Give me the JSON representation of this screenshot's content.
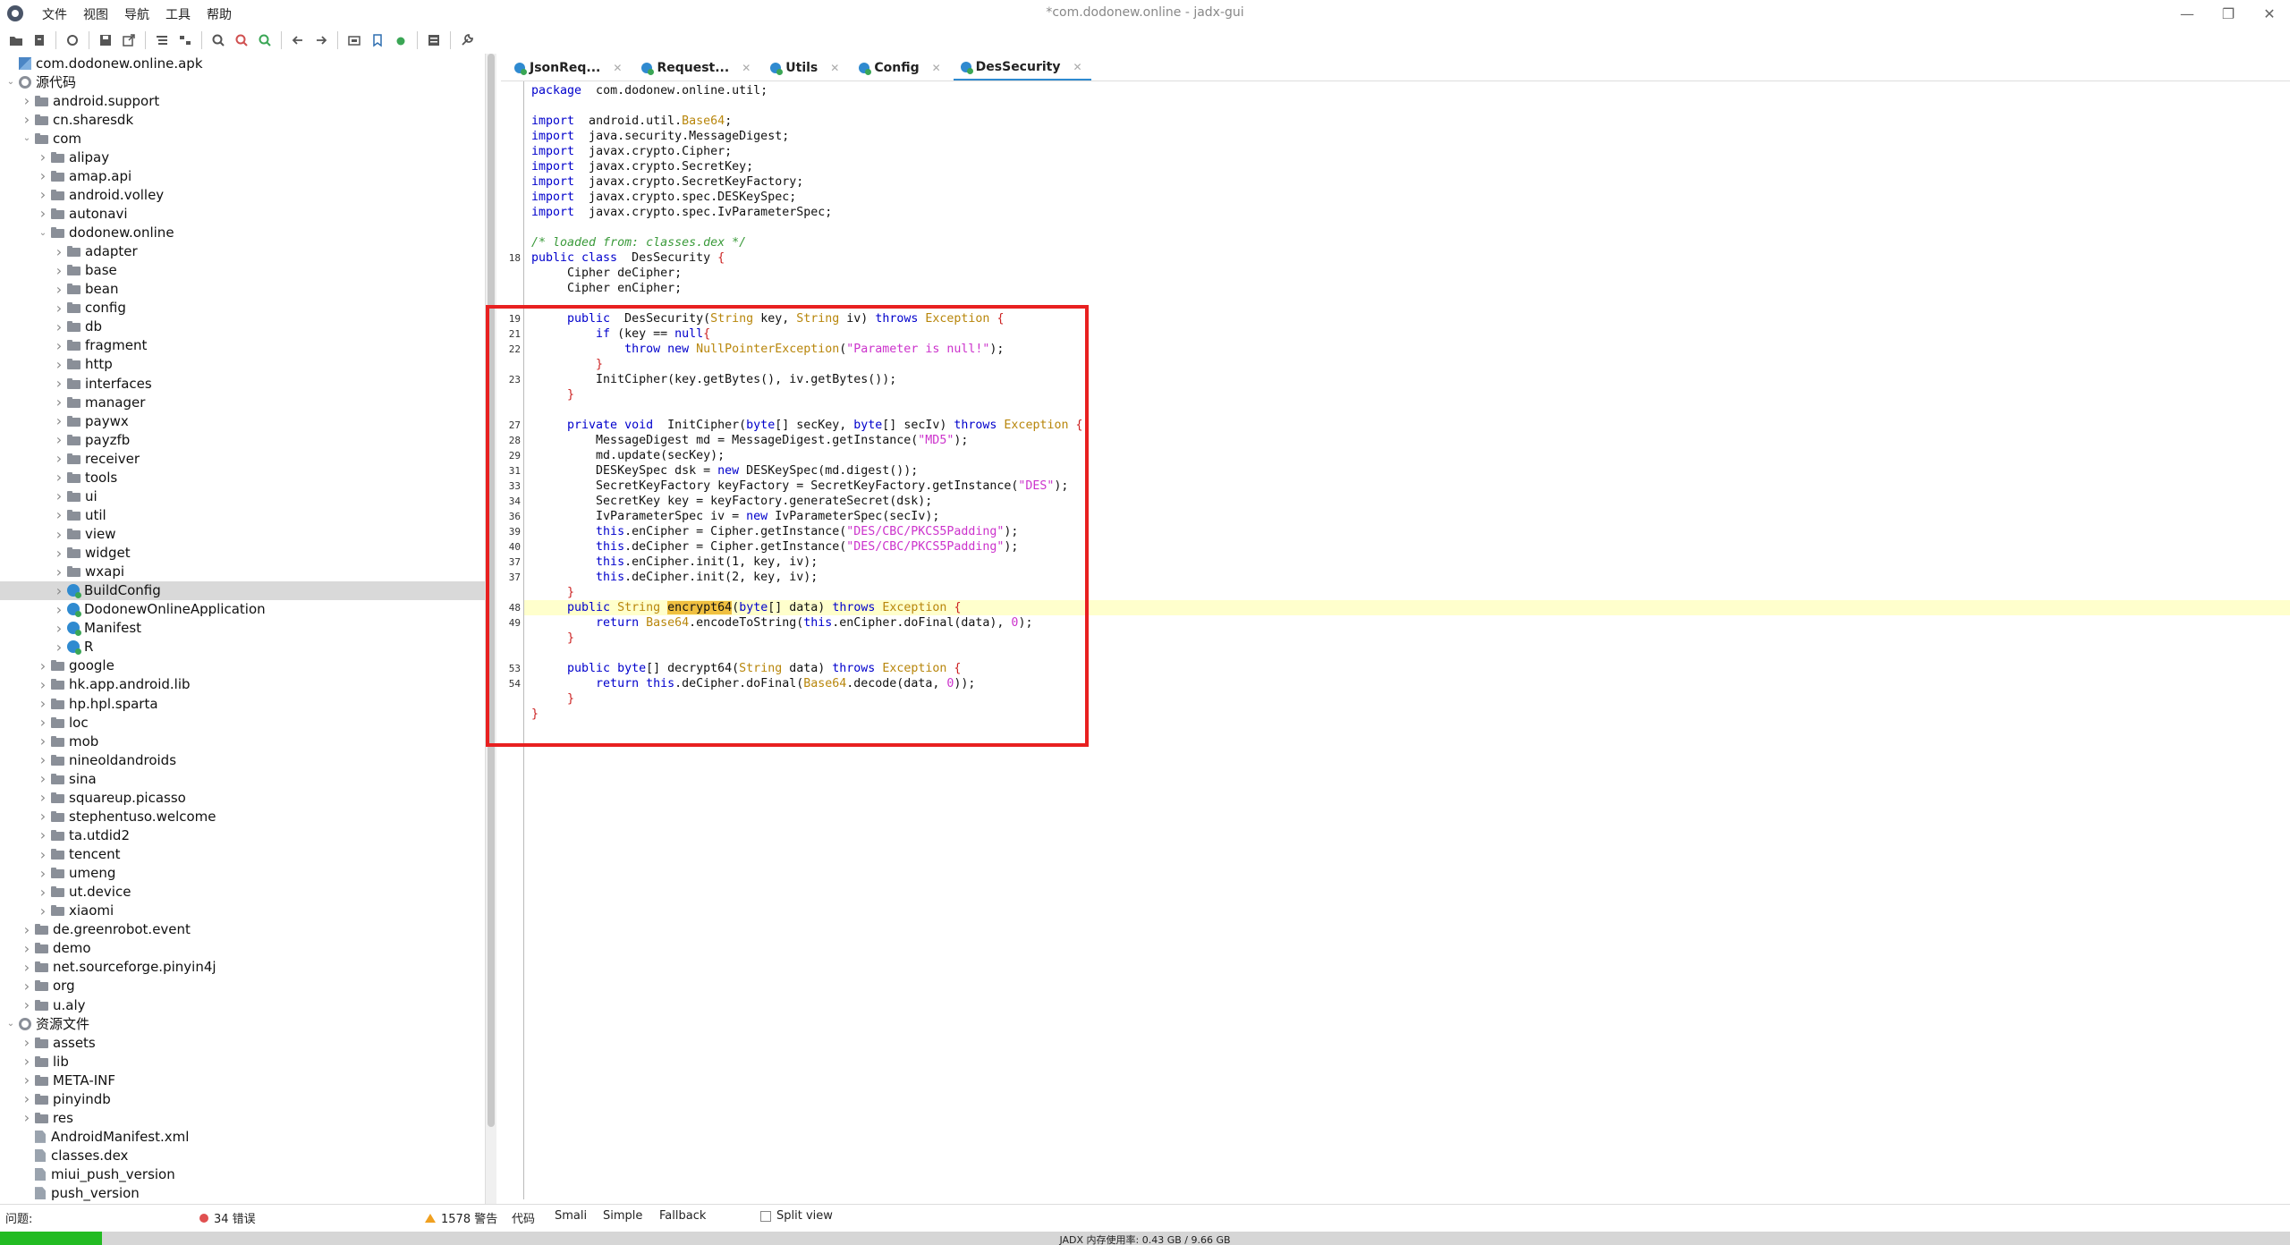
{
  "window": {
    "title": "*com.dodonew.online - jadx-gui",
    "menus": [
      "文件",
      "视图",
      "导航",
      "工具",
      "帮助"
    ],
    "controls": [
      "—",
      "❐",
      "✕"
    ]
  },
  "tree": {
    "rows": [
      {
        "label": "com.dodonew.online.apk",
        "depth": 0,
        "chev": "",
        "icon": "pkg"
      },
      {
        "label": "源代码",
        "depth": 0,
        "chev": "v",
        "icon": "gear"
      },
      {
        "label": "android.support",
        "depth": 1,
        "chev": ">",
        "icon": "folder"
      },
      {
        "label": "cn.sharesdk",
        "depth": 1,
        "chev": ">",
        "icon": "folder"
      },
      {
        "label": "com",
        "depth": 1,
        "chev": "v",
        "icon": "folder"
      },
      {
        "label": "alipay",
        "depth": 2,
        "chev": ">",
        "icon": "folder"
      },
      {
        "label": "amap.api",
        "depth": 2,
        "chev": ">",
        "icon": "folder"
      },
      {
        "label": "android.volley",
        "depth": 2,
        "chev": ">",
        "icon": "folder"
      },
      {
        "label": "autonavi",
        "depth": 2,
        "chev": ">",
        "icon": "folder"
      },
      {
        "label": "dodonew.online",
        "depth": 2,
        "chev": "v",
        "icon": "folder"
      },
      {
        "label": "adapter",
        "depth": 3,
        "chev": ">",
        "icon": "folder"
      },
      {
        "label": "base",
        "depth": 3,
        "chev": ">",
        "icon": "folder"
      },
      {
        "label": "bean",
        "depth": 3,
        "chev": ">",
        "icon": "folder"
      },
      {
        "label": "config",
        "depth": 3,
        "chev": ">",
        "icon": "folder"
      },
      {
        "label": "db",
        "depth": 3,
        "chev": ">",
        "icon": "folder"
      },
      {
        "label": "fragment",
        "depth": 3,
        "chev": ">",
        "icon": "folder"
      },
      {
        "label": "http",
        "depth": 3,
        "chev": ">",
        "icon": "folder"
      },
      {
        "label": "interfaces",
        "depth": 3,
        "chev": ">",
        "icon": "folder"
      },
      {
        "label": "manager",
        "depth": 3,
        "chev": ">",
        "icon": "folder"
      },
      {
        "label": "paywx",
        "depth": 3,
        "chev": ">",
        "icon": "folder"
      },
      {
        "label": "payzfb",
        "depth": 3,
        "chev": ">",
        "icon": "folder"
      },
      {
        "label": "receiver",
        "depth": 3,
        "chev": ">",
        "icon": "folder"
      },
      {
        "label": "tools",
        "depth": 3,
        "chev": ">",
        "icon": "folder"
      },
      {
        "label": "ui",
        "depth": 3,
        "chev": ">",
        "icon": "folder"
      },
      {
        "label": "util",
        "depth": 3,
        "chev": ">",
        "icon": "folder"
      },
      {
        "label": "view",
        "depth": 3,
        "chev": ">",
        "icon": "folder"
      },
      {
        "label": "widget",
        "depth": 3,
        "chev": ">",
        "icon": "folder"
      },
      {
        "label": "wxapi",
        "depth": 3,
        "chev": ">",
        "icon": "folder"
      },
      {
        "label": "BuildConfig",
        "depth": 3,
        "chev": ">",
        "icon": "class",
        "selected": true
      },
      {
        "label": "DodonewOnlineApplication",
        "depth": 3,
        "chev": ">",
        "icon": "class"
      },
      {
        "label": "Manifest",
        "depth": 3,
        "chev": ">",
        "icon": "class"
      },
      {
        "label": "R",
        "depth": 3,
        "chev": ">",
        "icon": "class"
      },
      {
        "label": "google",
        "depth": 2,
        "chev": ">",
        "icon": "folder"
      },
      {
        "label": "hk.app.android.lib",
        "depth": 2,
        "chev": ">",
        "icon": "folder"
      },
      {
        "label": "hp.hpl.sparta",
        "depth": 2,
        "chev": ">",
        "icon": "folder"
      },
      {
        "label": "loc",
        "depth": 2,
        "chev": ">",
        "icon": "folder"
      },
      {
        "label": "mob",
        "depth": 2,
        "chev": ">",
        "icon": "folder"
      },
      {
        "label": "nineoldandroids",
        "depth": 2,
        "chev": ">",
        "icon": "folder"
      },
      {
        "label": "sina",
        "depth": 2,
        "chev": ">",
        "icon": "folder"
      },
      {
        "label": "squareup.picasso",
        "depth": 2,
        "chev": ">",
        "icon": "folder"
      },
      {
        "label": "stephentuso.welcome",
        "depth": 2,
        "chev": ">",
        "icon": "folder"
      },
      {
        "label": "ta.utdid2",
        "depth": 2,
        "chev": ">",
        "icon": "folder"
      },
      {
        "label": "tencent",
        "depth": 2,
        "chev": ">",
        "icon": "folder"
      },
      {
        "label": "umeng",
        "depth": 2,
        "chev": ">",
        "icon": "folder"
      },
      {
        "label": "ut.device",
        "depth": 2,
        "chev": ">",
        "icon": "folder"
      },
      {
        "label": "xiaomi",
        "depth": 2,
        "chev": ">",
        "icon": "folder"
      },
      {
        "label": "de.greenrobot.event",
        "depth": 1,
        "chev": ">",
        "icon": "folder"
      },
      {
        "label": "demo",
        "depth": 1,
        "chev": ">",
        "icon": "folder"
      },
      {
        "label": "net.sourceforge.pinyin4j",
        "depth": 1,
        "chev": ">",
        "icon": "folder"
      },
      {
        "label": "org",
        "depth": 1,
        "chev": ">",
        "icon": "folder"
      },
      {
        "label": "u.aly",
        "depth": 1,
        "chev": ">",
        "icon": "folder"
      },
      {
        "label": "资源文件",
        "depth": 0,
        "chev": "v",
        "icon": "gear"
      },
      {
        "label": "assets",
        "depth": 1,
        "chev": ">",
        "icon": "folder"
      },
      {
        "label": "lib",
        "depth": 1,
        "chev": ">",
        "icon": "folder"
      },
      {
        "label": "META-INF",
        "depth": 1,
        "chev": ">",
        "icon": "folder"
      },
      {
        "label": "pinyindb",
        "depth": 1,
        "chev": ">",
        "icon": "folder"
      },
      {
        "label": "res",
        "depth": 1,
        "chev": ">",
        "icon": "folder"
      },
      {
        "label": "AndroidManifest.xml",
        "depth": 1,
        "chev": "",
        "icon": "file"
      },
      {
        "label": "classes.dex",
        "depth": 1,
        "chev": "",
        "icon": "file"
      },
      {
        "label": "miui_push_version",
        "depth": 1,
        "chev": "",
        "icon": "file"
      },
      {
        "label": "push_version",
        "depth": 1,
        "chev": "",
        "icon": "file"
      }
    ]
  },
  "tabs": [
    {
      "label": "JsonReq...",
      "active": false
    },
    {
      "label": "Request...",
      "active": false
    },
    {
      "label": "Utils",
      "active": false
    },
    {
      "label": "Config",
      "active": false
    },
    {
      "label": "DesSecurity",
      "active": true
    }
  ],
  "code": {
    "highlight_line_index": 34,
    "lines": [
      {
        "n": "",
        "t": [
          [
            "kw",
            "package"
          ],
          [
            "",
            "  com.dodonew.online.util;"
          ]
        ]
      },
      {
        "n": "",
        "t": []
      },
      {
        "n": "",
        "t": [
          [
            "kw",
            "import"
          ],
          [
            "",
            "  android.util."
          ],
          [
            "ty",
            "Base64"
          ],
          [
            "",
            ";"
          ]
        ]
      },
      {
        "n": "",
        "t": [
          [
            "kw",
            "import"
          ],
          [
            "",
            "  java.security.MessageDigest;"
          ]
        ]
      },
      {
        "n": "",
        "t": [
          [
            "kw",
            "import"
          ],
          [
            "",
            "  javax.crypto.Cipher;"
          ]
        ]
      },
      {
        "n": "",
        "t": [
          [
            "kw",
            "import"
          ],
          [
            "",
            "  javax.crypto.SecretKey;"
          ]
        ]
      },
      {
        "n": "",
        "t": [
          [
            "kw",
            "import"
          ],
          [
            "",
            "  javax.crypto.SecretKeyFactory;"
          ]
        ]
      },
      {
        "n": "",
        "t": [
          [
            "kw",
            "import"
          ],
          [
            "",
            "  javax.crypto.spec.DESKeySpec;"
          ]
        ]
      },
      {
        "n": "",
        "t": [
          [
            "kw",
            "import"
          ],
          [
            "",
            "  javax.crypto.spec.IvParameterSpec;"
          ]
        ]
      },
      {
        "n": "",
        "t": []
      },
      {
        "n": "",
        "t": [
          [
            "cm",
            "/* loaded from: classes.dex */"
          ]
        ]
      },
      {
        "n": "18",
        "t": [
          [
            "kw",
            "public class"
          ],
          [
            "",
            "  DesSecurity "
          ],
          [
            "brace",
            "{"
          ]
        ]
      },
      {
        "n": "",
        "t": [
          [
            "",
            "     Cipher deCipher;"
          ]
        ]
      },
      {
        "n": "",
        "t": [
          [
            "",
            "     Cipher enCipher;"
          ]
        ]
      },
      {
        "n": "",
        "t": []
      },
      {
        "n": "19",
        "t": [
          [
            "kw",
            "     public"
          ],
          [
            "",
            "  DesSecurity("
          ],
          [
            "ty",
            "String"
          ],
          [
            "",
            " key, "
          ],
          [
            "ty",
            "String"
          ],
          [
            "",
            " iv) "
          ],
          [
            "kw",
            "throws"
          ],
          [
            "",
            " "
          ],
          [
            "ty",
            "Exception"
          ],
          [
            "",
            " "
          ],
          [
            "brace",
            "{"
          ]
        ]
      },
      {
        "n": "21",
        "t": [
          [
            "kw",
            "         if"
          ],
          [
            "",
            " (key == "
          ],
          [
            "kw",
            "null"
          ],
          [
            ") "
          ],
          [
            "brace",
            "{"
          ]
        ]
      },
      {
        "n": "22",
        "t": [
          [
            "kw",
            "             throw new"
          ],
          [
            "",
            " "
          ],
          [
            "ty",
            "NullPointerException"
          ],
          [
            "",
            "("
          ],
          [
            "str",
            "\"Parameter is null!\""
          ],
          [
            "",
            ");"
          ]
        ]
      },
      {
        "n": "",
        "t": [
          [
            "brace",
            "         }"
          ]
        ]
      },
      {
        "n": "23",
        "t": [
          [
            "",
            "         InitCipher(key.getBytes(), iv.getBytes());"
          ]
        ]
      },
      {
        "n": "",
        "t": [
          [
            "brace",
            "     }"
          ]
        ]
      },
      {
        "n": "",
        "t": []
      },
      {
        "n": "27",
        "t": [
          [
            "kw",
            "     private void"
          ],
          [
            "",
            "  InitCipher("
          ],
          [
            "kw",
            "byte"
          ],
          [
            "",
            "[] secKey, "
          ],
          [
            "kw",
            "byte"
          ],
          [
            "",
            "[] secIv) "
          ],
          [
            "kw",
            "throws"
          ],
          [
            "",
            " "
          ],
          [
            "ty",
            "Exception"
          ],
          [
            "",
            " "
          ],
          [
            "brace",
            "{"
          ]
        ]
      },
      {
        "n": "28",
        "t": [
          [
            "",
            "         MessageDigest md = MessageDigest.getInstance("
          ],
          [
            "str",
            "\"MD5\""
          ],
          [
            "",
            ");"
          ]
        ]
      },
      {
        "n": "29",
        "t": [
          [
            "",
            "         md.update(secKey);"
          ]
        ]
      },
      {
        "n": "31",
        "t": [
          [
            "",
            "         DESKeySpec dsk = "
          ],
          [
            "kw",
            "new"
          ],
          [
            "",
            " DESKeySpec(md.digest());"
          ]
        ]
      },
      {
        "n": "33",
        "t": [
          [
            "",
            "         SecretKeyFactory keyFactory = SecretKeyFactory.getInstance("
          ],
          [
            "str",
            "\"DES\""
          ],
          [
            "",
            ");"
          ]
        ]
      },
      {
        "n": "34",
        "t": [
          [
            "",
            "         SecretKey key = keyFactory.generateSecret(dsk);"
          ]
        ]
      },
      {
        "n": "36",
        "t": [
          [
            "",
            "         IvParameterSpec iv = "
          ],
          [
            "kw",
            "new"
          ],
          [
            "",
            " IvParameterSpec(secIv);"
          ]
        ]
      },
      {
        "n": "39",
        "t": [
          [
            "kw",
            "         this"
          ],
          [
            "",
            ".enCipher = Cipher.getInstance("
          ],
          [
            "str",
            "\"DES/CBC/PKCS5Padding\""
          ],
          [
            "",
            ");"
          ]
        ]
      },
      {
        "n": "40",
        "t": [
          [
            "kw",
            "         this"
          ],
          [
            "",
            ".deCipher = Cipher.getInstance("
          ],
          [
            "str",
            "\"DES/CBC/PKCS5Padding\""
          ],
          [
            "",
            ");"
          ]
        ]
      },
      {
        "n": "37",
        "t": [
          [
            "kw",
            "         this"
          ],
          [
            "",
            ".enCipher.init(1, key, iv);"
          ]
        ]
      },
      {
        "n": "37",
        "t": [
          [
            "kw",
            "         this"
          ],
          [
            "",
            ".deCipher.init(2, key, iv);"
          ]
        ]
      },
      {
        "n": "",
        "t": [
          [
            "brace",
            "     }"
          ]
        ]
      },
      {
        "n": "48",
        "t": [
          [
            "kw",
            "     public"
          ],
          [
            "",
            " "
          ],
          [
            "ty",
            "String"
          ],
          [
            "",
            " "
          ],
          [
            "mark",
            "encrypt64"
          ],
          [
            "",
            "("
          ],
          [
            "kw",
            "byte"
          ],
          [
            "",
            "[] data) "
          ],
          [
            "kw",
            "throws"
          ],
          [
            "",
            " "
          ],
          [
            "ty",
            "Exception"
          ],
          [
            "",
            " "
          ],
          [
            "brace",
            "{"
          ]
        ]
      },
      {
        "n": "49",
        "t": [
          [
            "kw",
            "         return"
          ],
          [
            "",
            " "
          ],
          [
            "ty",
            "Base64"
          ],
          [
            "",
            ".encodeToString("
          ],
          [
            "kw",
            "this"
          ],
          [
            "",
            ".enCipher.doFinal(data), "
          ],
          [
            "num",
            "0"
          ],
          [
            "",
            ");"
          ]
        ]
      },
      {
        "n": "",
        "t": [
          [
            "brace",
            "     }"
          ]
        ]
      },
      {
        "n": "",
        "t": []
      },
      {
        "n": "53",
        "t": [
          [
            "kw",
            "     public byte"
          ],
          [
            "",
            "[] decrypt64("
          ],
          [
            "ty",
            "String"
          ],
          [
            "",
            " data) "
          ],
          [
            "kw",
            "throws"
          ],
          [
            "",
            " "
          ],
          [
            "ty",
            "Exception"
          ],
          [
            "",
            " "
          ],
          [
            "brace",
            "{"
          ]
        ]
      },
      {
        "n": "54",
        "t": [
          [
            "kw",
            "         return this"
          ],
          [
            "",
            ".deCipher.doFinal("
          ],
          [
            "ty",
            "Base64"
          ],
          [
            "",
            ".decode(data, "
          ],
          [
            "num",
            "0"
          ],
          [
            "",
            "));"
          ]
        ]
      },
      {
        "n": "",
        "t": [
          [
            "brace",
            "     }"
          ]
        ]
      },
      {
        "n": "",
        "t": [
          [
            "brace",
            "}"
          ]
        ]
      }
    ]
  },
  "status": {
    "problems_label": "问题:",
    "errors": "34 错误",
    "warnings": "1578 警告",
    "view_tabs": [
      "代码",
      "Smali",
      "Simple",
      "Fallback"
    ],
    "split_view": "Split view"
  },
  "memory": {
    "label": "JADX 内存使用率: 0.43 GB / 9.66 GB",
    "used_fraction": 0.0445
  }
}
